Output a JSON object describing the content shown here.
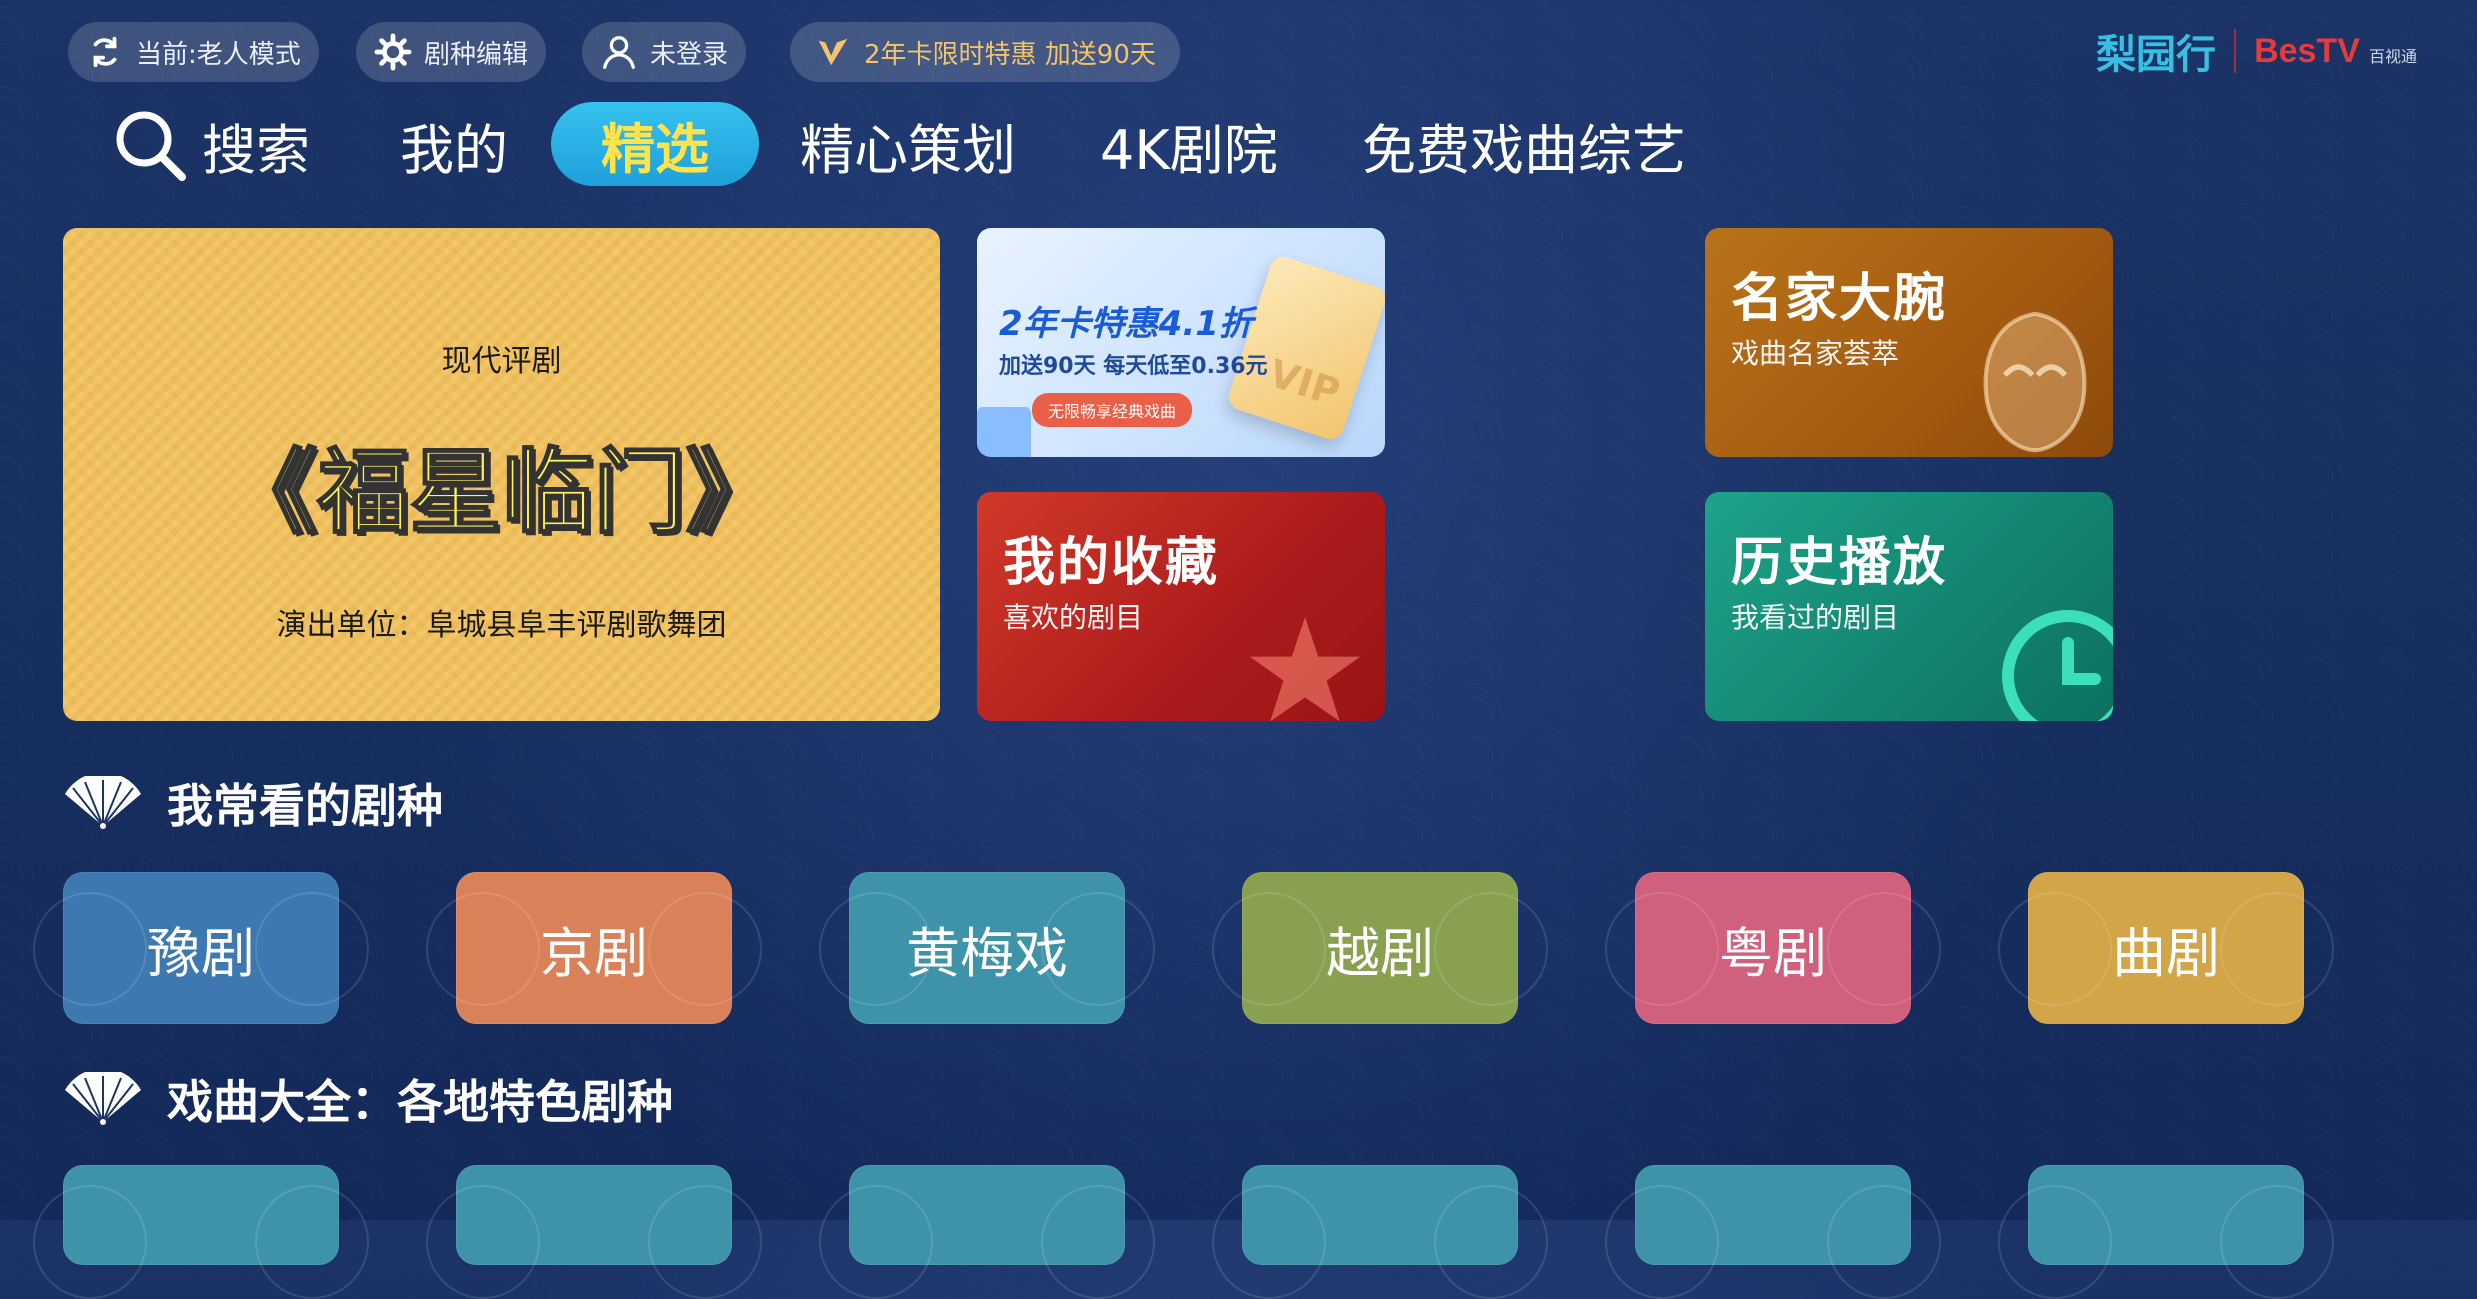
{
  "top_bar": {
    "mode_label": "当前:老人模式",
    "edit_label": "剧种编辑",
    "login_label": "未登录",
    "vip_label": "2年卡限时特惠 加送90天"
  },
  "logo": {
    "liyuan": "梨园行",
    "bestv": "BesTV",
    "bestv_sub": "百视通"
  },
  "nav": {
    "items": [
      "搜索",
      "我的",
      "精选",
      "精心策划",
      "4K剧院",
      "免费戏曲综艺"
    ],
    "active": "精选"
  },
  "feature": {
    "subtitle": "现代评剧",
    "title": "《福星临门》",
    "unit": "演出单位：阜城县阜丰评剧歌舞团"
  },
  "promo": {
    "line1": "2年卡特惠4.1折",
    "line2": "加送90天 每天低至0.36元",
    "tag": "无限畅享经典戏曲",
    "card_text": "VIP"
  },
  "tiles": {
    "favorites": {
      "title": "我的收藏",
      "subtitle": "喜欢的剧目"
    },
    "masters": {
      "title": "名家大腕",
      "subtitle": "戏曲名家荟萃"
    },
    "history": {
      "title": "历史播放",
      "subtitle": "我看过的剧目"
    }
  },
  "sections": {
    "frequent": "我常看的剧种",
    "all": "戏曲大全：各地特色剧种"
  },
  "genres": [
    {
      "label": "豫剧",
      "color": "#3d78b0"
    },
    {
      "label": "京剧",
      "color": "#d9825a"
    },
    {
      "label": "黄梅戏",
      "color": "#3f93a9"
    },
    {
      "label": "越剧",
      "color": "#88a050"
    },
    {
      "label": "粤剧",
      "color": "#d1607c"
    },
    {
      "label": "曲剧",
      "color": "#d2a548"
    }
  ],
  "genres_row2_colors": [
    "#3f93a9",
    "#3f93a9",
    "#3f93a9",
    "#3f93a9",
    "#3f93a9",
    "#3f93a9"
  ]
}
